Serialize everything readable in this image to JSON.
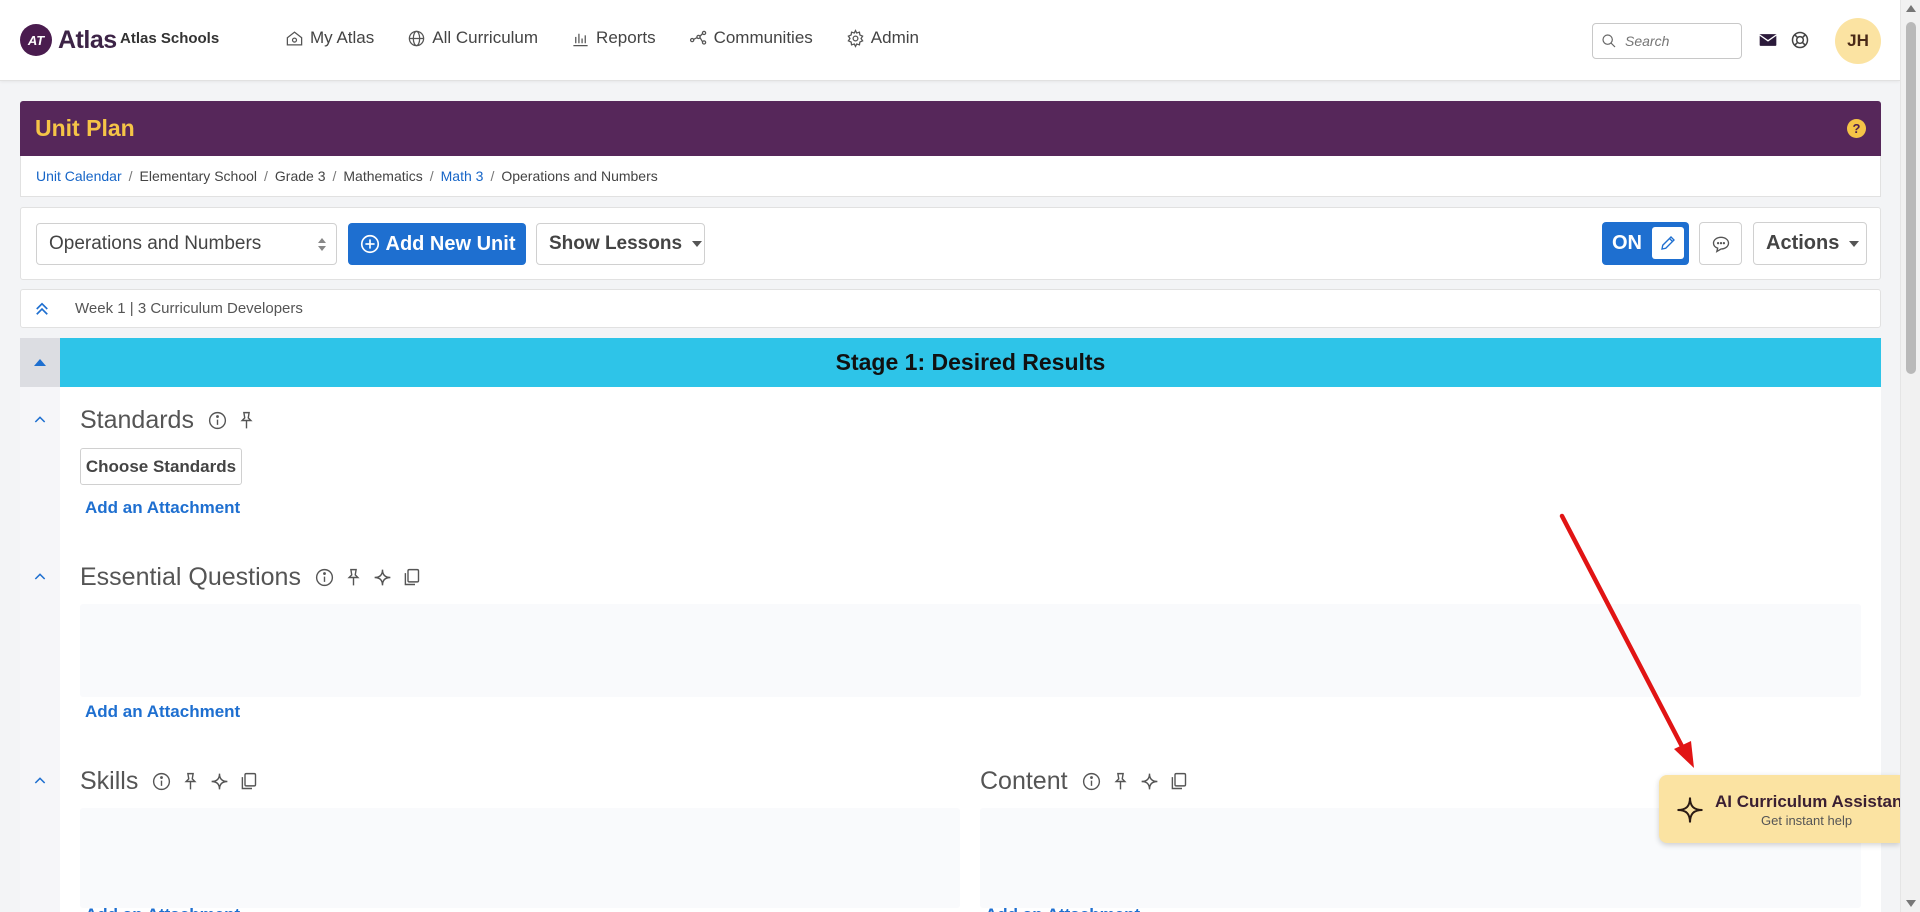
{
  "app": {
    "logo_mark": "AT",
    "logo_text": "Atlas",
    "school": "Atlas Schools"
  },
  "nav": {
    "items": [
      {
        "label": "My Atlas",
        "icon": "home-icon"
      },
      {
        "label": "All Curriculum",
        "icon": "globe-icon"
      },
      {
        "label": "Reports",
        "icon": "bar-chart-icon"
      },
      {
        "label": "Communities",
        "icon": "network-icon"
      },
      {
        "label": "Admin",
        "icon": "gear-icon"
      }
    ],
    "search_placeholder": "Search",
    "avatar_initials": "JH"
  },
  "header": {
    "title": "Unit Plan",
    "help": "?"
  },
  "breadcrumb": {
    "items": [
      "Unit Calendar",
      "Elementary School",
      "Grade 3",
      "Mathematics",
      "Math 3",
      "Operations and Numbers"
    ],
    "separator": "/"
  },
  "toolbar": {
    "unit_select": "Operations and Numbers",
    "add_unit": "Add New Unit",
    "show_lessons": "Show Lessons",
    "edit_toggle": "ON",
    "actions": "Actions"
  },
  "week": {
    "text": "Week 1 |  3 Curriculum Developers"
  },
  "stage": {
    "title": "Stage 1: Desired Results"
  },
  "sections": {
    "standards": "Standards",
    "choose_standards": "Choose Standards",
    "essential_questions": "Essential Questions",
    "skills": "Skills",
    "content": "Content",
    "add_attachment": "Add an Attachment"
  },
  "ai_assistant": {
    "title": "AI Curriculum Assistant",
    "subtitle": "Get instant help"
  },
  "colors": {
    "header_bg": "#56275a",
    "header_text": "#f5c447",
    "primary": "#1e6fd0",
    "stage_bar": "#2ec4e8",
    "ai_bg": "#fbe3a2",
    "annotation_arrow": "#e11414"
  }
}
